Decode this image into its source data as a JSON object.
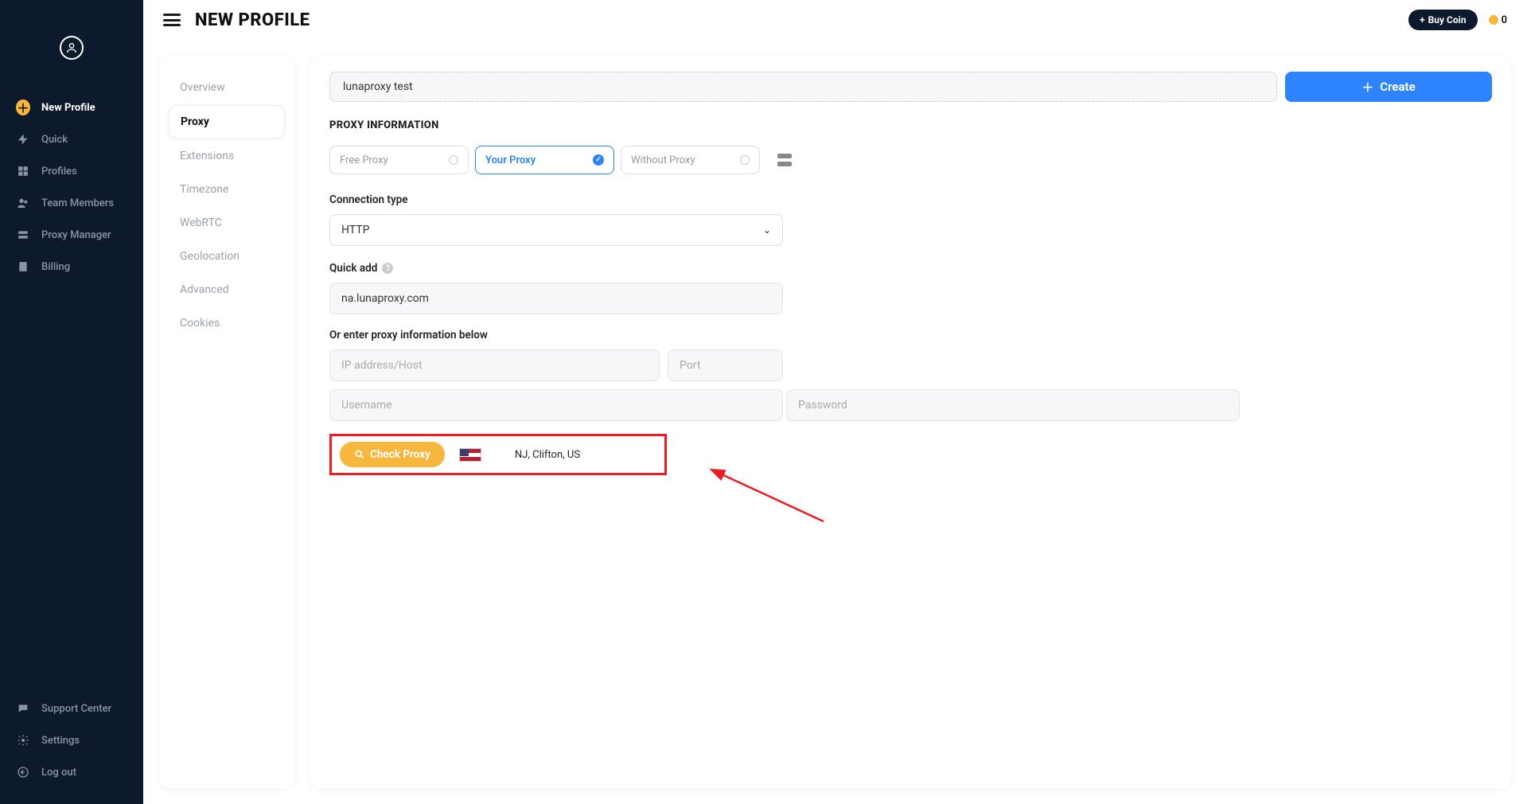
{
  "header": {
    "page_title": "NEW PROFILE",
    "buy_coin_label": "Buy Coin",
    "coin_balance": "0"
  },
  "sidebar": {
    "items": [
      {
        "label": "New Profile",
        "icon": "plus-circle-icon",
        "primary": true
      },
      {
        "label": "Quick",
        "icon": "bolt-icon"
      },
      {
        "label": "Profiles",
        "icon": "grid-icon"
      },
      {
        "label": "Team Members",
        "icon": "users-icon"
      },
      {
        "label": "Proxy Manager",
        "icon": "stack-icon"
      },
      {
        "label": "Billing",
        "icon": "receipt-icon"
      }
    ],
    "bottom": [
      {
        "label": "Support Center",
        "icon": "support-icon"
      },
      {
        "label": "Settings",
        "icon": "gear-icon"
      },
      {
        "label": "Log out",
        "icon": "logout-icon"
      }
    ]
  },
  "sub_sidebar": {
    "items": [
      "Overview",
      "Proxy",
      "Extensions",
      "Timezone",
      "WebRTC",
      "Geolocation",
      "Advanced",
      "Cookies"
    ],
    "active_index": 1
  },
  "form": {
    "profile_name_value": "lunaproxy test",
    "create_label": "Create",
    "section_title": "PROXY INFORMATION",
    "proxy_modes": {
      "free": "Free Proxy",
      "your": "Your Proxy",
      "without": "Without Proxy"
    },
    "connection_type": {
      "label": "Connection type",
      "value": "HTTP"
    },
    "quick_add": {
      "label": "Quick add",
      "value": "na.lunaproxy.com"
    },
    "manual_label": "Or enter proxy information below",
    "placeholders": {
      "host": "IP address/Host",
      "port": "Port",
      "username": "Username",
      "password": "Password"
    },
    "check_proxy": {
      "button_label": "Check Proxy",
      "ip": "",
      "location": "NJ, Clifton, US"
    }
  }
}
